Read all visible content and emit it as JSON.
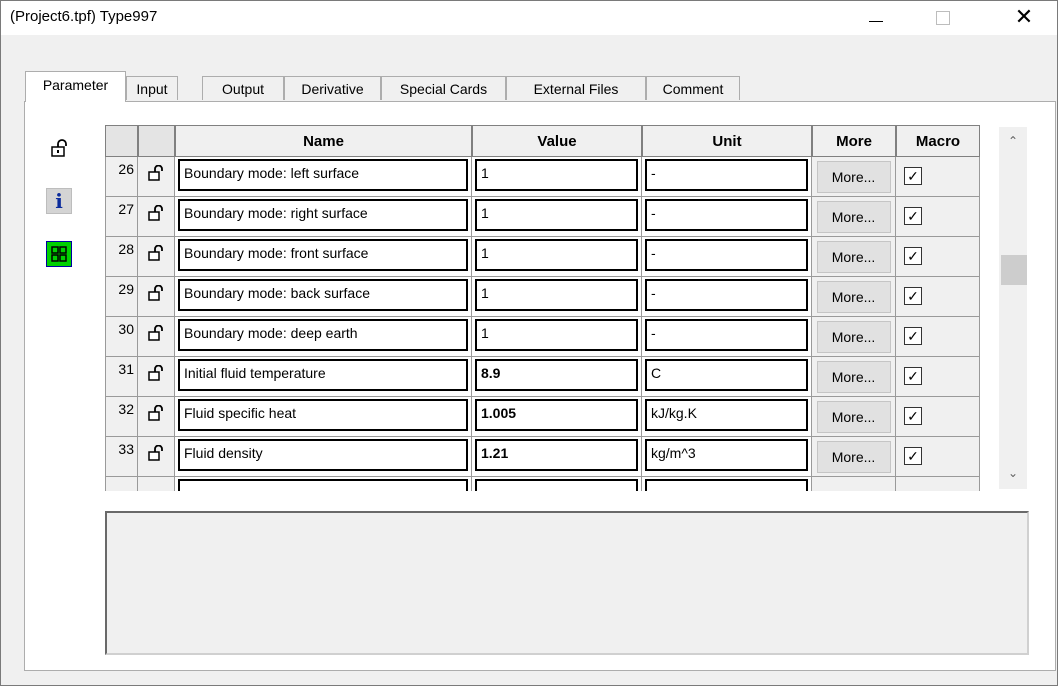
{
  "window": {
    "title": "(Project6.tpf) Type997",
    "minimize_glyph": "—",
    "close_glyph": "✕"
  },
  "tabs": [
    {
      "label": "Parameter"
    },
    {
      "label": "Input"
    },
    {
      "label": "Output"
    },
    {
      "label": "Derivative"
    },
    {
      "label": "Special Cards"
    },
    {
      "label": "External Files"
    },
    {
      "label": "Comment"
    }
  ],
  "side_icons": [
    "lock-icon",
    "info-icon",
    "grid-icon"
  ],
  "table": {
    "columns": [
      "Name",
      "Value",
      "Unit",
      "More",
      "Macro"
    ],
    "more_label": "More...",
    "rows": [
      {
        "num": "26",
        "name": "Boundary mode: left surface",
        "value": "1",
        "unit": "-",
        "macro": true,
        "bold": false
      },
      {
        "num": "27",
        "name": "Boundary mode: right surface",
        "value": "1",
        "unit": "-",
        "macro": true,
        "bold": false
      },
      {
        "num": "28",
        "name": "Boundary mode: front surface",
        "value": "1",
        "unit": "-",
        "macro": true,
        "bold": false
      },
      {
        "num": "29",
        "name": "Boundary mode: back surface",
        "value": "1",
        "unit": "-",
        "macro": true,
        "bold": false
      },
      {
        "num": "30",
        "name": "Boundary mode: deep earth",
        "value": "1",
        "unit": "-",
        "macro": true,
        "bold": false
      },
      {
        "num": "31",
        "name": "Initial fluid temperature",
        "value": "8.9",
        "unit": "C",
        "macro": true,
        "bold": true
      },
      {
        "num": "32",
        "name": "Fluid specific heat",
        "value": "1.005",
        "unit": "kJ/kg.K",
        "macro": true,
        "bold": true
      },
      {
        "num": "33",
        "name": "Fluid density",
        "value": "1.21",
        "unit": "kg/m^3",
        "macro": true,
        "bold": true
      }
    ]
  },
  "scrollbar": {
    "up": "⌃",
    "down": "⌄"
  },
  "icons": {
    "lock": "🔓",
    "info": "i",
    "check": "✓"
  }
}
